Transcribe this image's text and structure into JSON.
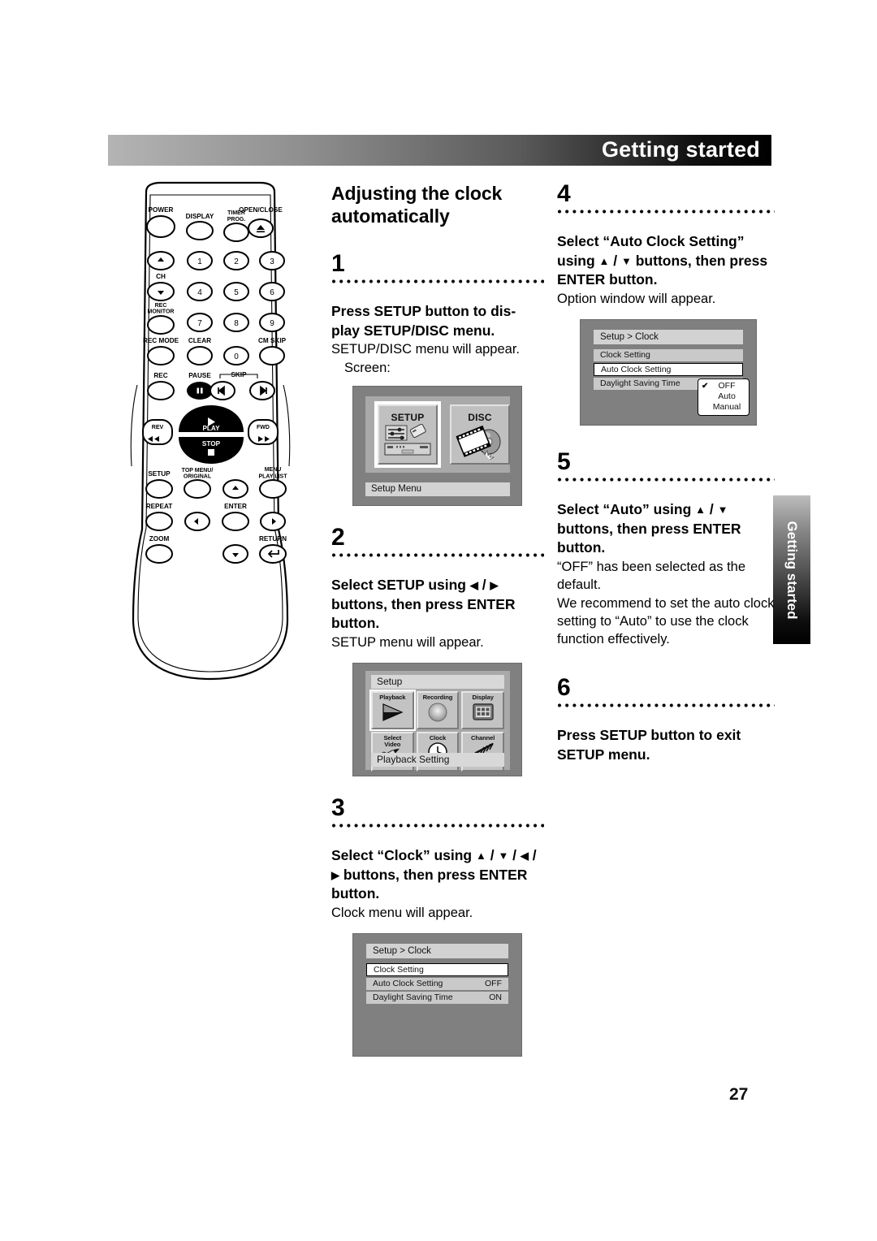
{
  "header": {
    "title": "Getting started"
  },
  "side_tab": {
    "label": "Getting started"
  },
  "page_number": "27",
  "section": {
    "title": "Adjusting the clock automatically"
  },
  "steps": [
    {
      "number": "1",
      "heading": "Press SETUP button to dis-play SETUP/DISC menu.",
      "body": "SETUP/DISC menu will appear.",
      "body2": "Screen:"
    },
    {
      "number": "2",
      "heading_a": "Select SETUP using ",
      "heading_b": " / ",
      "heading_c": " buttons, then press ENTER button.",
      "body": "SETUP menu will appear."
    },
    {
      "number": "3",
      "heading_a": "Select “Clock” using ",
      "heading_b": " / ",
      "heading_c": " / ",
      "heading_d": " / ",
      "heading_e": " buttons, then press ENTER button.",
      "body": "Clock menu will appear."
    },
    {
      "number": "4",
      "heading_a": "Select “Auto Clock Setting” using ",
      "heading_b": " / ",
      "heading_c": " buttons, then press ENTER button.",
      "body": "Option window will appear."
    },
    {
      "number": "5",
      "heading_a": "Select “Auto” using ",
      "heading_b": " / ",
      "heading_c": " buttons, then press ENTER button.",
      "body": "“OFF” has been selected as the default.",
      "body2": "We recommend to set the auto clock setting to “Auto” to use the clock function effectively."
    },
    {
      "number": "6",
      "heading": "Press SETUP button to exit SETUP menu."
    }
  ],
  "arrows": {
    "up": "▲",
    "down": "▼",
    "left": "◀",
    "right": "▶"
  },
  "screen_setup_disc": {
    "tiles": [
      {
        "label": "SETUP",
        "selected": true
      },
      {
        "label": "DISC",
        "selected": false
      }
    ],
    "status": "Setup Menu"
  },
  "screen_setup_menu": {
    "title": "Setup",
    "cells": [
      {
        "label": "Playback",
        "selected": true
      },
      {
        "label": "Recording",
        "selected": false
      },
      {
        "label": "Display",
        "selected": false
      },
      {
        "label": "Select\nVideo",
        "selected": false
      },
      {
        "label": "Clock",
        "selected": false
      },
      {
        "label": "Channel",
        "selected": false
      }
    ],
    "status": "Playback Setting"
  },
  "screen_clock_menu": {
    "title": "Setup > Clock",
    "rows": [
      {
        "label": "Clock Setting",
        "value": "",
        "highlight": true
      },
      {
        "label": "Auto Clock Setting",
        "value": "OFF",
        "highlight": false
      },
      {
        "label": "Daylight Saving Time",
        "value": "ON",
        "highlight": false
      }
    ]
  },
  "screen_clock_option": {
    "title": "Setup > Clock",
    "rows": [
      {
        "label": "Clock Setting",
        "value": "",
        "highlight": false
      },
      {
        "label": "Auto Clock Setting",
        "value": "",
        "highlight": true
      },
      {
        "label": "Daylight Saving Time",
        "value": "",
        "highlight": false
      }
    ],
    "options": [
      {
        "label": "OFF",
        "checked": true
      },
      {
        "label": "Auto",
        "checked": false
      },
      {
        "label": "Manual",
        "checked": false
      }
    ],
    "check_glyph": "✔"
  },
  "remote": {
    "labels": {
      "power": "POWER",
      "display": "DISPLAY",
      "timer_prog_1": "TIMER",
      "timer_prog_2": "PROG.",
      "open_close": "OPEN/CLOSE",
      "ch": "CH",
      "rec_monitor_1": "REC",
      "rec_monitor_2": "MONITOR",
      "rec_mode": "REC MODE",
      "clear": "CLEAR",
      "cm_skip": "CM SKIP",
      "rec": "REC",
      "pause": "PAUSE",
      "skip": "SKIP",
      "play": "PLAY",
      "stop": "STOP",
      "rev": "REV",
      "fwd": "FWD",
      "setup": "SETUP",
      "top_menu_1": "TOP MENU/",
      "top_menu_2": "ORIGINAL",
      "menu_playlist_1": "MENU",
      "menu_playlist_2": "PLAY LIST",
      "repeat": "REPEAT",
      "enter": "ENTER",
      "zoom": "ZOOM",
      "return": "RETURN",
      "n0": "0",
      "n1": "1",
      "n2": "2",
      "n3": "3",
      "n4": "4",
      "n5": "5",
      "n6": "6",
      "n7": "7",
      "n8": "8",
      "n9": "9"
    }
  }
}
